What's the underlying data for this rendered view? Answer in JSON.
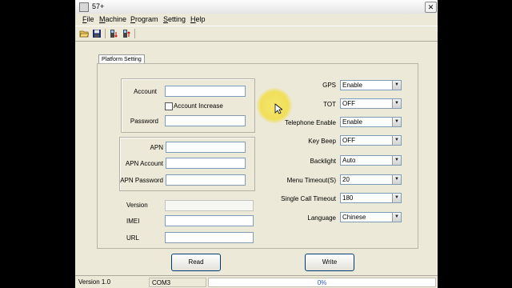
{
  "window": {
    "title": "57+",
    "close_glyph": "✕"
  },
  "menu": {
    "file": {
      "key": "F",
      "rest": "ile"
    },
    "machine": {
      "key": "M",
      "rest": "achine"
    },
    "program": {
      "key": "P",
      "rest": "rogram"
    },
    "setting": {
      "key": "S",
      "rest": "etting"
    },
    "help": {
      "key": "H",
      "rest": "elp"
    }
  },
  "toolbar": {
    "icons": [
      "open-folder-icon",
      "save-disk-icon",
      "read-radio-icon",
      "write-radio-icon"
    ]
  },
  "tab": {
    "label": "Platform Setting"
  },
  "account_group": {
    "account_label": "Account",
    "account_value": "",
    "account_increase_label": "Account Increase",
    "account_increase_checked": false,
    "password_label": "Password",
    "password_value": ""
  },
  "apn_group": {
    "apn_label": "APN",
    "apn_value": "",
    "apn_account_label": "APN Account",
    "apn_account_value": "",
    "apn_password_label": "APN Password",
    "apn_password_value": ""
  },
  "info": {
    "version_label": "Version",
    "version_value": "",
    "imei_label": "IMEI",
    "imei_value": "",
    "url_label": "URL",
    "url_value": ""
  },
  "settings": {
    "gps": {
      "label": "GPS",
      "value": "Enable"
    },
    "tot": {
      "label": "TOT",
      "value": "OFF"
    },
    "telephone_enable": {
      "label": "Telephone Enable",
      "value": "Enable"
    },
    "key_beep": {
      "label": "Key Beep",
      "value": "OFF"
    },
    "backlight": {
      "label": "Backlight",
      "value": "Auto"
    },
    "menu_timeout": {
      "label": "Menu Timeout(S)",
      "value": "20"
    },
    "single_call_timeout": {
      "label": "Single Call Timeout",
      "value": "180"
    },
    "language": {
      "label": "Language",
      "value": "Chinese"
    }
  },
  "buttons": {
    "read": "Read",
    "write": "Write"
  },
  "status": {
    "version": "Version 1.0",
    "port": "COM3",
    "progress_text": "0%",
    "progress": 0
  },
  "colors": {
    "highlight": "#f2dd44",
    "button_border": "#003c74"
  }
}
